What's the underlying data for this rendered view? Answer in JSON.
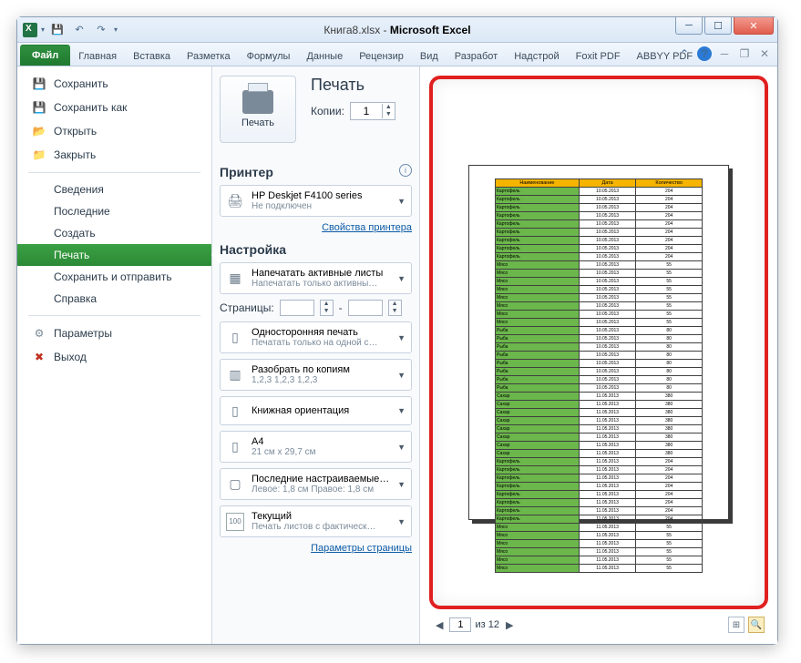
{
  "title": {
    "doc": "Книга8.xlsx",
    "app": "Microsoft Excel"
  },
  "tabs": [
    "Файл",
    "Главная",
    "Вставка",
    "Разметка",
    "Формулы",
    "Данные",
    "Рецензир",
    "Вид",
    "Разработ",
    "Надстрой",
    "Foxit PDF",
    "ABBYY PDF"
  ],
  "menu": {
    "save": "Сохранить",
    "save_as": "Сохранить как",
    "open": "Открыть",
    "close": "Закрыть",
    "info": "Сведения",
    "recent": "Последние",
    "new": "Создать",
    "print": "Печать",
    "send": "Сохранить и отправить",
    "help": "Справка",
    "options": "Параметры",
    "exit": "Выход"
  },
  "print": {
    "heading": "Печать",
    "button": "Печать",
    "copies_label": "Копии:",
    "copies_value": "1",
    "printer_heading": "Принтер",
    "printer_name": "HP Deskjet F4100 series",
    "printer_status": "Не подключен",
    "printer_props": "Свойства принтера",
    "settings_heading": "Настройка",
    "what": {
      "main": "Напечатать активные листы",
      "sub": "Напечатать только активны…"
    },
    "pages_label": "Страницы:",
    "pages_sep": "-",
    "sides": {
      "main": "Односторонняя печать",
      "sub": "Печатать только на одной с…"
    },
    "collate": {
      "main": "Разобрать по копиям",
      "sub": "1,2,3   1,2,3   1,2,3"
    },
    "orient": {
      "main": "Книжная ориентация",
      "sub": ""
    },
    "paper": {
      "main": "A4",
      "sub": "21 см x 29,7 см"
    },
    "margins": {
      "main": "Последние настраиваемые …",
      "sub": "Левое: 1,8 см   Правое: 1,8 см"
    },
    "scale": {
      "main": "Текущий",
      "sub": "Печать листов с фактическ…"
    },
    "page_setup": "Параметры страницы"
  },
  "preview": {
    "page_current": "1",
    "page_of": "из 12",
    "headers": [
      "Наименование",
      "Дата",
      "Количество"
    ],
    "chart_data": {
      "type": "table",
      "rows": [
        [
          "Картофель",
          "10.05.2013",
          "204"
        ],
        [
          "Картофель",
          "10.05.2013",
          "204"
        ],
        [
          "Картофель",
          "10.05.2013",
          "204"
        ],
        [
          "Картофель",
          "10.05.2013",
          "204"
        ],
        [
          "Картофель",
          "10.05.2013",
          "204"
        ],
        [
          "Картофель",
          "10.05.2013",
          "204"
        ],
        [
          "Картофель",
          "10.05.2013",
          "204"
        ],
        [
          "Картофель",
          "10.05.2013",
          "204"
        ],
        [
          "Картофель",
          "10.05.2013",
          "204"
        ],
        [
          "Мясо",
          "10.05.2013",
          "55"
        ],
        [
          "Мясо",
          "10.05.2013",
          "55"
        ],
        [
          "Мясо",
          "10.05.2013",
          "55"
        ],
        [
          "Мясо",
          "10.05.2013",
          "55"
        ],
        [
          "Мясо",
          "10.05.2013",
          "55"
        ],
        [
          "Мясо",
          "10.05.2013",
          "55"
        ],
        [
          "Мясо",
          "10.05.2013",
          "55"
        ],
        [
          "Мясо",
          "10.05.2013",
          "55"
        ],
        [
          "Рыба",
          "10.05.2013",
          "80"
        ],
        [
          "Рыба",
          "10.05.2013",
          "80"
        ],
        [
          "Рыба",
          "10.05.2013",
          "80"
        ],
        [
          "Рыба",
          "10.05.2013",
          "80"
        ],
        [
          "Рыба",
          "10.05.2013",
          "80"
        ],
        [
          "Рыба",
          "10.05.2013",
          "80"
        ],
        [
          "Рыба",
          "10.05.2013",
          "80"
        ],
        [
          "Рыба",
          "10.05.2013",
          "80"
        ],
        [
          "Сахар",
          "11.05.2013",
          "380"
        ],
        [
          "Сахар",
          "11.05.2013",
          "380"
        ],
        [
          "Сахар",
          "11.05.2013",
          "380"
        ],
        [
          "Сахар",
          "11.05.2013",
          "380"
        ],
        [
          "Сахар",
          "11.05.2013",
          "380"
        ],
        [
          "Сахар",
          "11.05.2013",
          "380"
        ],
        [
          "Сахар",
          "11.05.2013",
          "380"
        ],
        [
          "Сахар",
          "11.05.2013",
          "380"
        ],
        [
          "Картофель",
          "11.05.2013",
          "204"
        ],
        [
          "Картофель",
          "11.05.2013",
          "204"
        ],
        [
          "Картофель",
          "11.05.2013",
          "204"
        ],
        [
          "Картофель",
          "11.05.2013",
          "204"
        ],
        [
          "Картофель",
          "11.05.2013",
          "204"
        ],
        [
          "Картофель",
          "11.05.2013",
          "204"
        ],
        [
          "Картофель",
          "11.05.2013",
          "204"
        ],
        [
          "Картофель",
          "11.05.2013",
          "204"
        ],
        [
          "Мясо",
          "11.05.2013",
          "55"
        ],
        [
          "Мясо",
          "11.05.2013",
          "55"
        ],
        [
          "Мясо",
          "11.05.2013",
          "55"
        ],
        [
          "Мясо",
          "11.05.2013",
          "55"
        ],
        [
          "Мясо",
          "11.05.2013",
          "55"
        ],
        [
          "Мясо",
          "11.05.2013",
          "55"
        ]
      ]
    }
  }
}
